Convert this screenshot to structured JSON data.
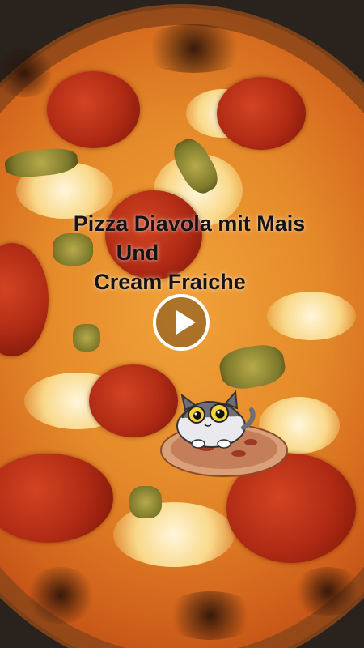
{
  "caption": {
    "line1": "Pizza Diavola mit Mais",
    "line2": "Und",
    "line3": "Cream Fraiche"
  },
  "player": {
    "play_icon": "play-icon"
  },
  "sticker": {
    "icon": "cat-on-pizza-sticker"
  },
  "colors": {
    "caption_text": "#141414",
    "play_button": "#ffffff"
  }
}
